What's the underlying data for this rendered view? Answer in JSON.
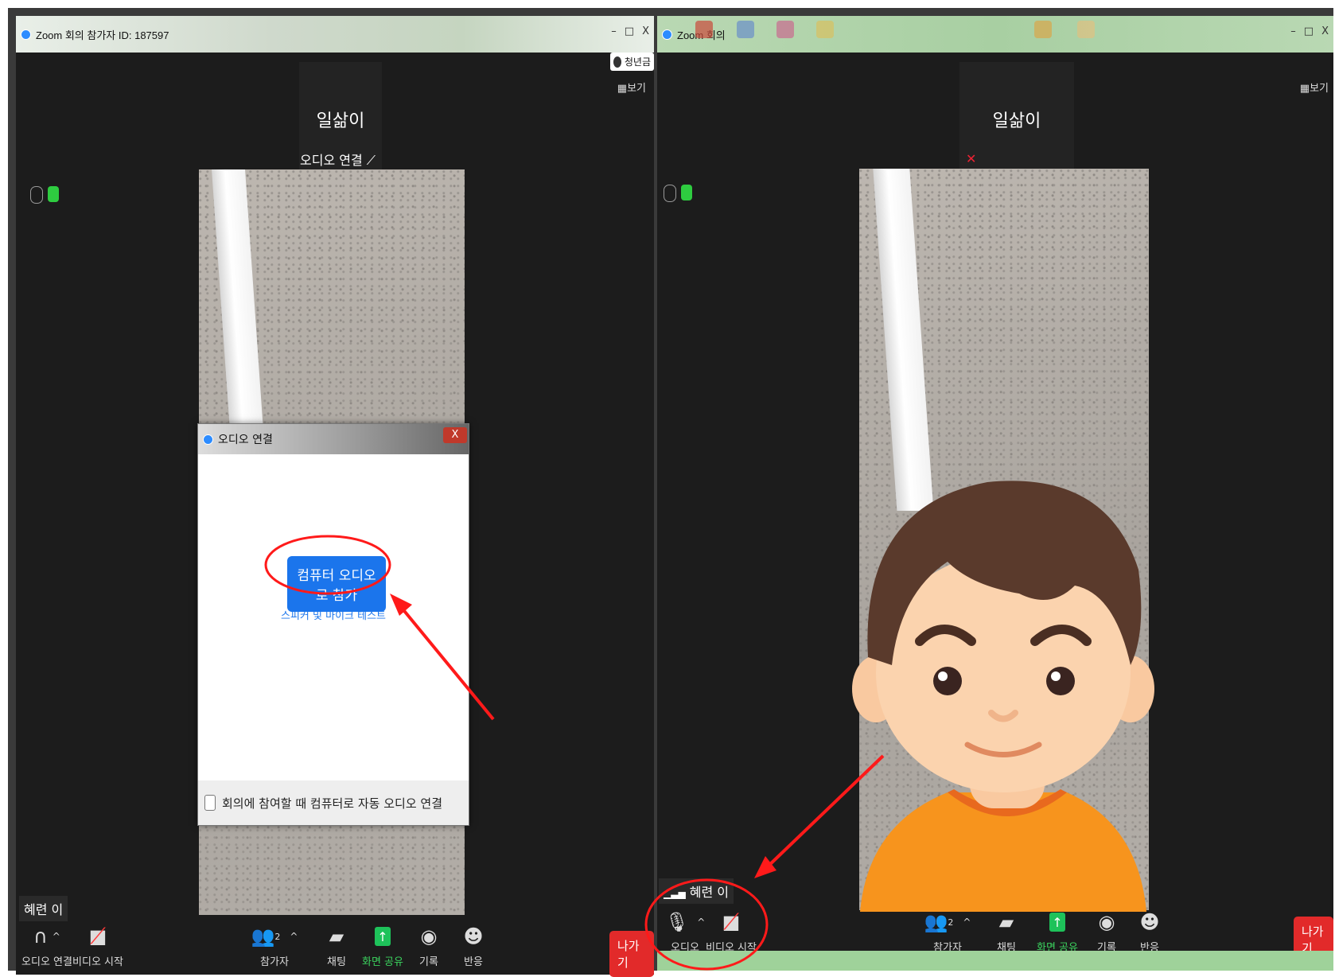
{
  "left_window": {
    "title": "Zoom 회의 참가자 ID: 187597",
    "win_buttons": [
      "–",
      "□",
      "X"
    ],
    "popup_name": "청년금",
    "view_label": "보기",
    "participant_name": "일삶이",
    "audio_connect_label": "오디오 연결 ⟋",
    "self_name": "혜련 이",
    "toolbar": {
      "audio": "오디오 연결",
      "video": "비디오 시작",
      "participants": "참가자",
      "participant_count": "2",
      "chat": "채팅",
      "share": "화면 공유",
      "record": "기록",
      "react": "반응",
      "leave": "나가기"
    }
  },
  "dialog": {
    "title": "오디오 연결",
    "close": "X",
    "join_button": "컴퓨터 오디오로 참가",
    "test_link": "스피커 및 마이크 테스트",
    "auto_checkbox": "회의에 참여할 때 컴퓨터로 자동 오디오 연결"
  },
  "right_window": {
    "title": "Zoom 회의",
    "win_buttons": [
      "–",
      "□",
      "X"
    ],
    "view_label": "보기",
    "participant_name": "일삶이",
    "self_name": "혜련 이",
    "toolbar": {
      "audio": "오디오",
      "video": "비디오 시작",
      "participants": "참가자",
      "participant_count": "2",
      "chat": "채팅",
      "share": "화면 공유",
      "record": "기록",
      "react": "반응",
      "leave": "나가기"
    }
  },
  "colors": {
    "zoom_blue": "#1b75ec",
    "leave_red": "#e22a2a",
    "share_green": "#1ec25a",
    "annotation_red": "#ff1a1a"
  }
}
